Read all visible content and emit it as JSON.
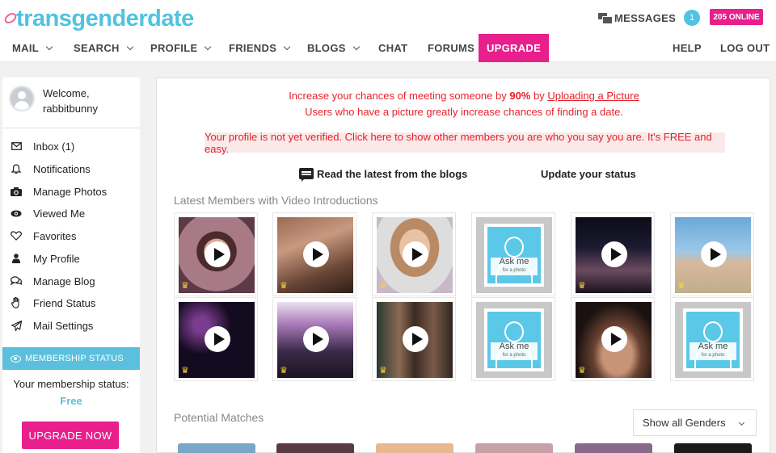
{
  "header": {
    "logo_text": "transgenderdate",
    "messages_label": "MESSAGES",
    "messages_count": "1",
    "online_badge": "205 ONLINE"
  },
  "nav": {
    "items": [
      {
        "label": "MAIL",
        "dropdown": true
      },
      {
        "label": "SEARCH",
        "dropdown": true
      },
      {
        "label": "PROFILE",
        "dropdown": true
      },
      {
        "label": "FRIENDS",
        "dropdown": true
      },
      {
        "label": "BLOGS",
        "dropdown": true
      },
      {
        "label": "CHAT",
        "dropdown": false
      },
      {
        "label": "FORUMS",
        "dropdown": false
      },
      {
        "label": "UPGRADE",
        "dropdown": false,
        "active": true
      }
    ],
    "help": "HELP",
    "logout": "LOG OUT"
  },
  "sidebar": {
    "welcome": "Welcome,",
    "username": "rabbitbunny",
    "items": [
      {
        "label": "Inbox (1)",
        "icon": "envelope-icon"
      },
      {
        "label": "Notifications",
        "icon": "bell-icon"
      },
      {
        "label": "Manage Photos",
        "icon": "camera-icon"
      },
      {
        "label": "Viewed Me",
        "icon": "eye-icon"
      },
      {
        "label": "Favorites",
        "icon": "heart-icon"
      },
      {
        "label": "My Profile",
        "icon": "user-icon"
      },
      {
        "label": "Manage Blog",
        "icon": "comments-icon"
      },
      {
        "label": "Friend Status",
        "icon": "hand-icon"
      },
      {
        "label": "Mail Settings",
        "icon": "paper-plane-icon"
      }
    ],
    "membership_header": "MEMBERSHIP STATUS",
    "membership_label": "Your membership status:",
    "membership_value": "Free",
    "upgrade_button": "UPGRADE NOW"
  },
  "main": {
    "promo": {
      "prefix": "Increase your chances of meeting someone by ",
      "percent": "90%",
      "middle": " by ",
      "link": "Uploading a Picture",
      "line2": "Users who have a picture greatly increase chances of finding a date."
    },
    "verify_notice": "Your profile is not yet verified. Click here to show other members you are who you say you are. It's FREE and easy.",
    "blogs_link": "Read the latest from the blogs",
    "status_link": "Update your status",
    "video_section_title": "Latest Members with Video Introductions",
    "ask_me": "Ask me",
    "ask_me_sub": "for a photo",
    "matches_section_title": "Potential Matches",
    "gender_select": "Show all Genders"
  },
  "colors": {
    "brand_pink": "#e81f8c",
    "brand_blue": "#5bc0de",
    "alert_red": "#e8212b"
  }
}
